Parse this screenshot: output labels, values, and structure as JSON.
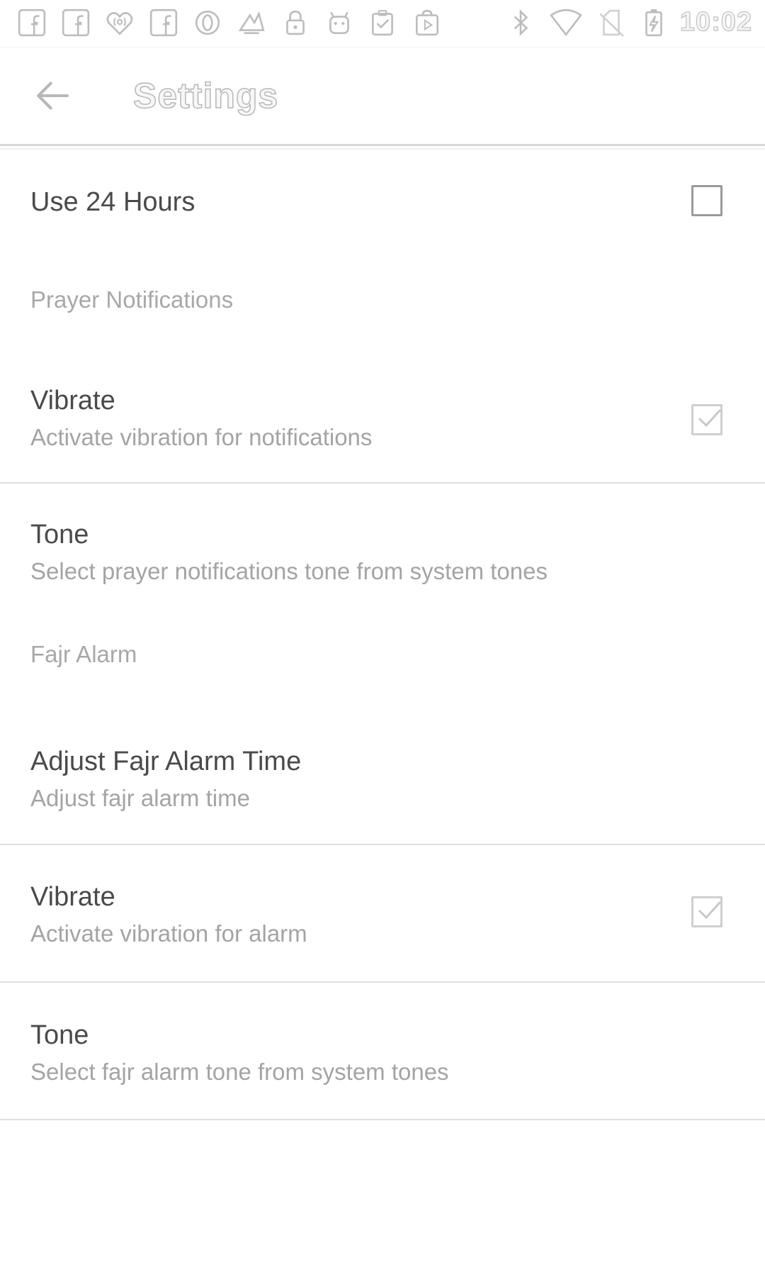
{
  "status_bar": {
    "time": "10:02",
    "left_icons": [
      "facebook-icon",
      "facebook-icon",
      "iheartradio-icon",
      "facebook-icon",
      "opera-icon",
      "pokemon-go-icon",
      "lock-icon",
      "android-icon",
      "checklist-icon",
      "play-store-icon"
    ],
    "right_icons": [
      "bluetooth-icon",
      "wifi-icon",
      "no-sim-icon",
      "battery-charging-icon"
    ]
  },
  "app_bar": {
    "title": "Settings",
    "back_icon": "arrow-back-icon"
  },
  "settings": {
    "use24": {
      "title": "Use 24 Hours",
      "checked": false
    },
    "prayer_category": "Prayer Notifications",
    "prayer_vibrate": {
      "title": "Vibrate",
      "summary": "Activate vibration for notifications",
      "checked": true
    },
    "prayer_tone": {
      "title": "Tone",
      "summary": "Select prayer notifications tone from system tones"
    },
    "fajr_category": "Fajr Alarm",
    "fajr_adjust": {
      "title": "Adjust Fajr Alarm Time",
      "summary": "Adjust fajr alarm time"
    },
    "fajr_vibrate": {
      "title": "Vibrate",
      "summary": "Activate vibration for alarm",
      "checked": true
    },
    "fajr_tone": {
      "title": "Tone",
      "summary": "Select fajr alarm tone from system tones"
    }
  },
  "colors": {
    "background": "#ffffff",
    "title_text": "#4a4a4a",
    "summary_text": "#a4a4a4",
    "divider": "#dedede"
  }
}
